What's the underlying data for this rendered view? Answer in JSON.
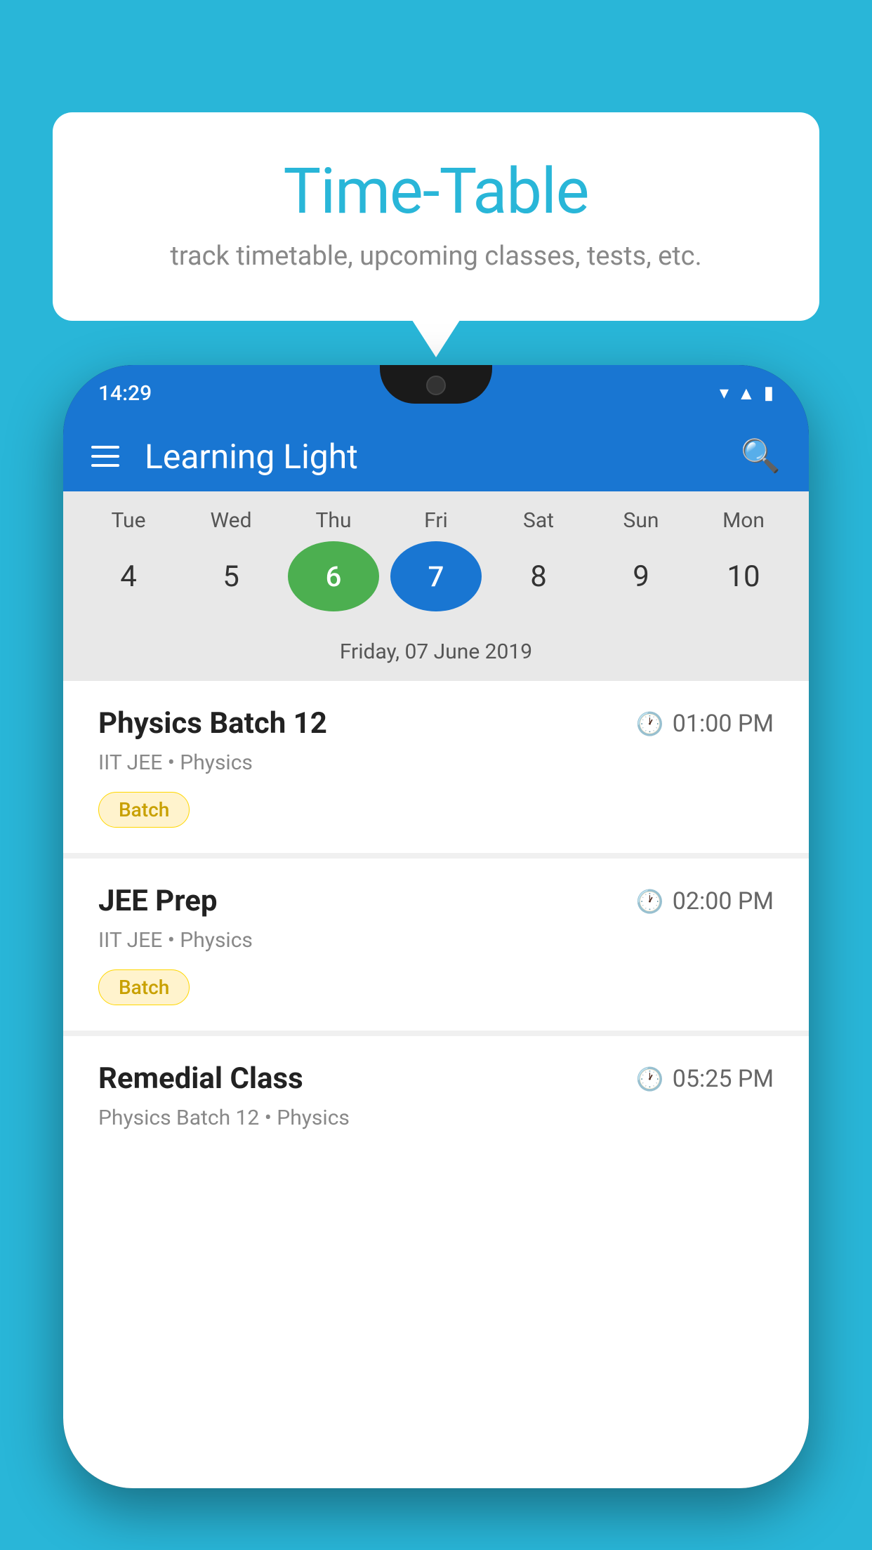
{
  "background_color": "#29b6d8",
  "bubble": {
    "title": "Time-Table",
    "subtitle": "track timetable, upcoming classes, tests, etc."
  },
  "phone": {
    "status_bar": {
      "time": "14:29"
    },
    "app_header": {
      "title": "Learning Light"
    },
    "calendar": {
      "days": [
        {
          "label": "Tue",
          "number": "4",
          "style": "normal"
        },
        {
          "label": "Wed",
          "number": "5",
          "style": "normal"
        },
        {
          "label": "Thu",
          "number": "6",
          "style": "green"
        },
        {
          "label": "Fri",
          "number": "7",
          "style": "blue"
        },
        {
          "label": "Sat",
          "number": "8",
          "style": "normal"
        },
        {
          "label": "Sun",
          "number": "9",
          "style": "normal"
        },
        {
          "label": "Mon",
          "number": "10",
          "style": "normal"
        }
      ],
      "selected_date_label": "Friday, 07 June 2019"
    },
    "classes": [
      {
        "name": "Physics Batch 12",
        "time": "01:00 PM",
        "meta": "IIT JEE • Physics",
        "badge": "Batch"
      },
      {
        "name": "JEE Prep",
        "time": "02:00 PM",
        "meta": "IIT JEE • Physics",
        "badge": "Batch"
      },
      {
        "name": "Remedial Class",
        "time": "05:25 PM",
        "meta": "Physics Batch 12 • Physics",
        "badge": null
      }
    ]
  }
}
